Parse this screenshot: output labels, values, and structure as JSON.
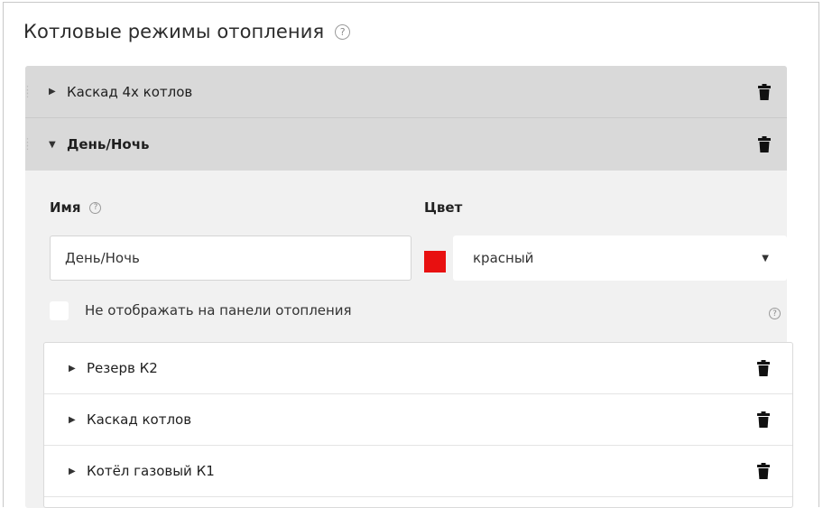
{
  "section": {
    "title": "Котловые режимы отопления",
    "help_icon": "?"
  },
  "modes": [
    {
      "label": "Каскад 4х котлов",
      "expanded": false
    },
    {
      "label": "День/Ночь",
      "expanded": true
    }
  ],
  "editor": {
    "name_label": "Имя",
    "name_help": "?",
    "name_value": "День/Ночь",
    "color_label": "Цвет",
    "color_swatch": "#e81010",
    "color_value": "красный",
    "hide_checkbox_label": "Не отображать на панели отопления",
    "hide_checked": false,
    "hide_help": "?"
  },
  "submodes": [
    {
      "label": "Резерв К2"
    },
    {
      "label": "Каскад котлов"
    },
    {
      "label": "Котёл газовый К1"
    }
  ],
  "glyphs": {
    "caret_right": "▶",
    "caret_down": "▼",
    "select_arrow": "▼",
    "grip": "⋮"
  }
}
